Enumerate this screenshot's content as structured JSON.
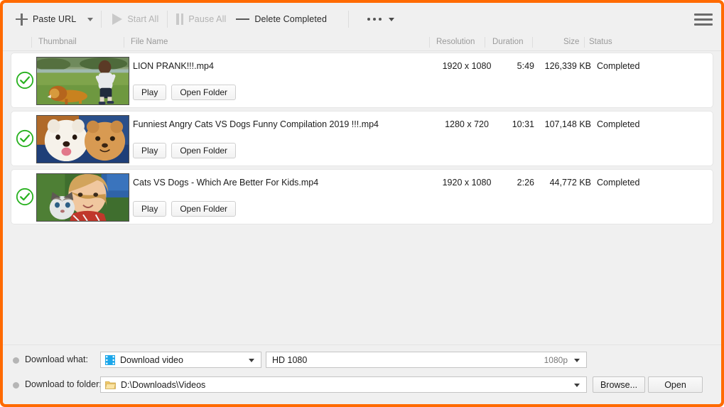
{
  "window": {
    "accent_color": "#ff6a00",
    "chrome_background": "#f0f0f0"
  },
  "toolbar": {
    "paste_url_label": "Paste URL",
    "start_all_label": "Start All",
    "pause_all_label": "Pause All",
    "delete_completed_label": "Delete Completed",
    "more_menu_label": "",
    "menu_label": ""
  },
  "columns": {
    "thumbnail": "Thumbnail",
    "file_name": "File Name",
    "resolution": "Resolution",
    "duration": "Duration",
    "size": "Size",
    "status": "Status"
  },
  "row_actions": {
    "play_label": "Play",
    "open_folder_label": "Open Folder"
  },
  "downloads": [
    {
      "file_name": "LION PRANK!!!.mp4",
      "resolution": "1920 x 1080",
      "duration": "5:49",
      "size": "126,339 KB",
      "status": "Completed",
      "checked": true
    },
    {
      "file_name": "Funniest Angry Cats VS Dogs Funny Compilation 2019 !!!.mp4",
      "resolution": "1280 x 720",
      "duration": "10:31",
      "size": "107,148 KB",
      "status": "Completed",
      "checked": true
    },
    {
      "file_name": "Cats VS Dogs - Which Are Better For Kids.mp4",
      "resolution": "1920 x 1080",
      "duration": "2:26",
      "size": "44,772 KB",
      "status": "Completed",
      "checked": true
    }
  ],
  "bottom": {
    "download_what_label": "Download what:",
    "download_to_folder_label": "Download to folder:",
    "download_type_value": "Download video",
    "quality_value": "HD 1080",
    "quality_tag": "1080p",
    "folder_value": "D:\\Downloads\\Videos",
    "browse_label": "Browse...",
    "open_label": "Open"
  }
}
